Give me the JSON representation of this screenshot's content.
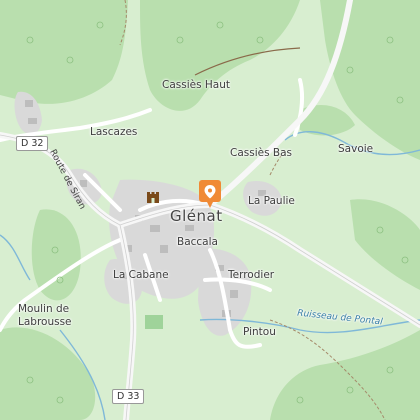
{
  "map": {
    "places": {
      "main": "Glénat",
      "cassies_haut": "Cassiès Haut",
      "lascazes": "Lascazes",
      "cassies_bas": "Cassiès Bas",
      "savoie": "Savoie",
      "la_paulie": "La Paulie",
      "baccala": "Baccala",
      "la_cabane": "La Cabane",
      "terrodier": "Terrodier",
      "pintou": "Pintou",
      "moulin_line1": "Moulin de",
      "moulin_line2": "Labrousse"
    },
    "roads": {
      "d32": "D 32",
      "d33": "D 33",
      "route_siran": "Route de Siran"
    },
    "waterways": {
      "ruisseau": "Ruisseau de Pontal"
    },
    "icons": [
      "location-pin-icon",
      "castle-icon"
    ],
    "colors": {
      "background": "#d8eed0",
      "forest": "#b9dfae",
      "built_area": "#dcdcdc",
      "water": "#7fb8d8",
      "pin": "#f08a35"
    }
  }
}
